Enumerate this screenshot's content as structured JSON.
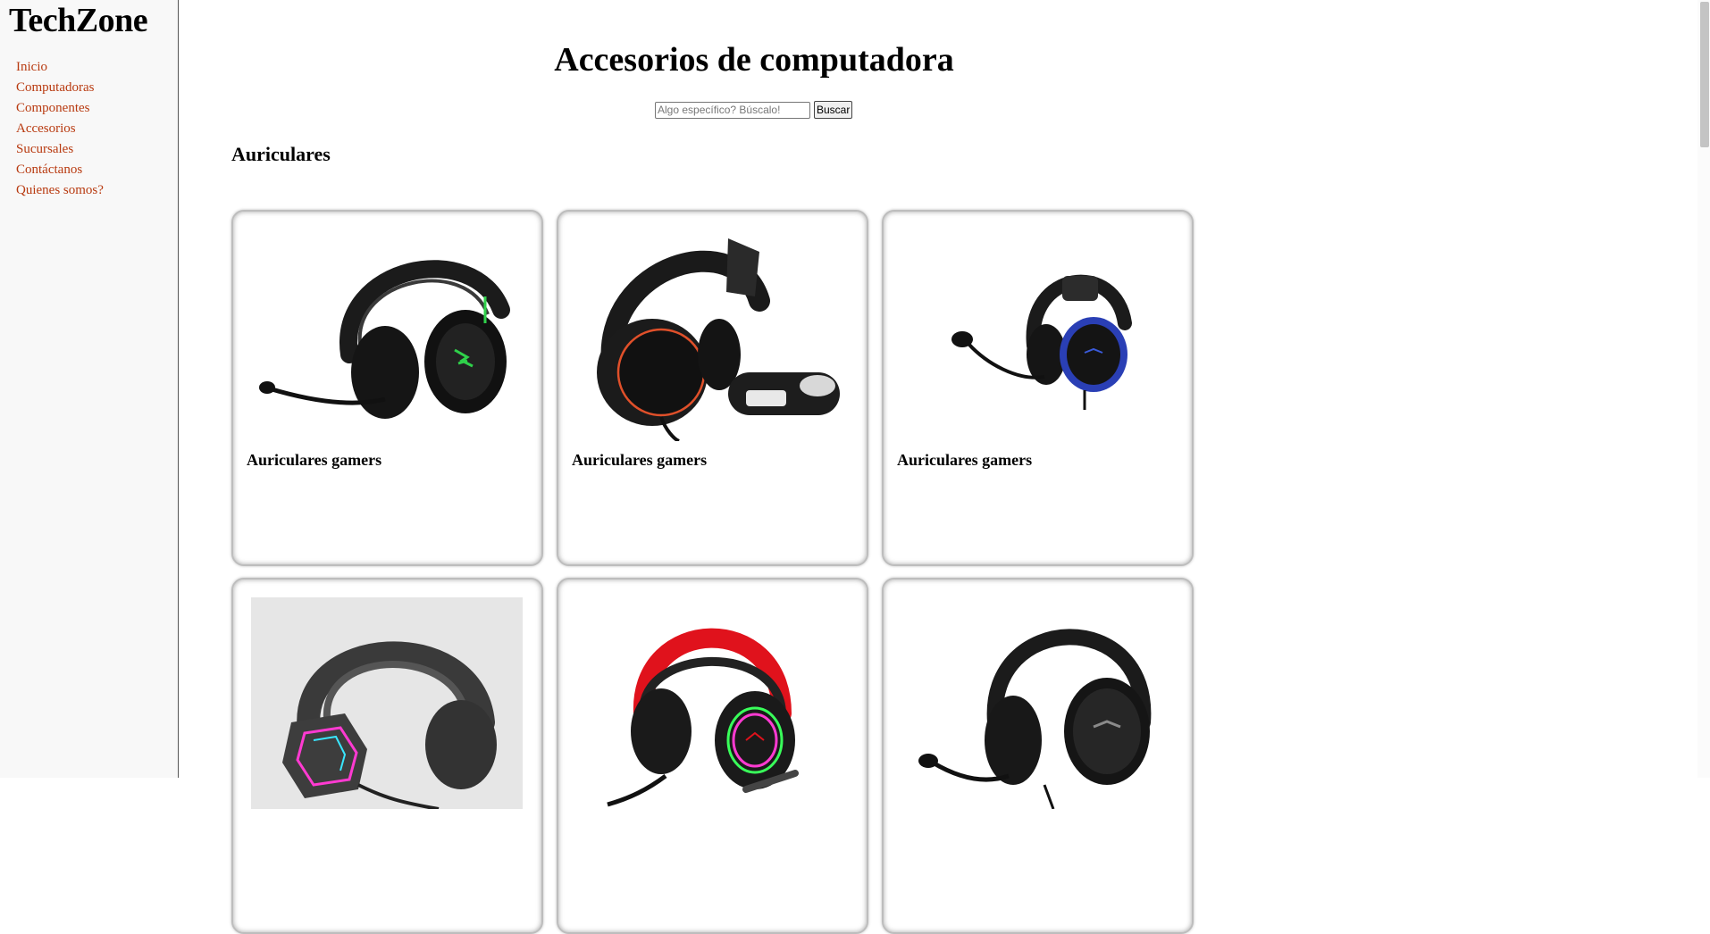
{
  "brand": "TechZone",
  "nav": [
    {
      "label": "Inicio"
    },
    {
      "label": "Computadoras"
    },
    {
      "label": "Componentes"
    },
    {
      "label": "Accesorios"
    },
    {
      "label": "Sucursales"
    },
    {
      "label": "Contáctanos"
    },
    {
      "label": "Quienes somos?"
    }
  ],
  "page_title": "Accesorios de computadora",
  "search": {
    "placeholder": "Algo específico? Búscalo!",
    "button_label": "Buscar"
  },
  "section": {
    "title": "Auriculares"
  },
  "products": [
    {
      "name": "Auriculares gamers",
      "accent": "#2fd14a"
    },
    {
      "name": "Auriculares gamers",
      "accent": "#e0502a"
    },
    {
      "name": "Auriculares gamers",
      "accent": "#2a3fb5"
    },
    {
      "name": "",
      "accent": "#ff3ad1"
    },
    {
      "name": "",
      "accent": "#e0121c"
    },
    {
      "name": "",
      "accent": "#8a8a8a"
    }
  ],
  "colors": {
    "link": "#b83a10",
    "sidebar_bg": "#f8f8f8"
  }
}
